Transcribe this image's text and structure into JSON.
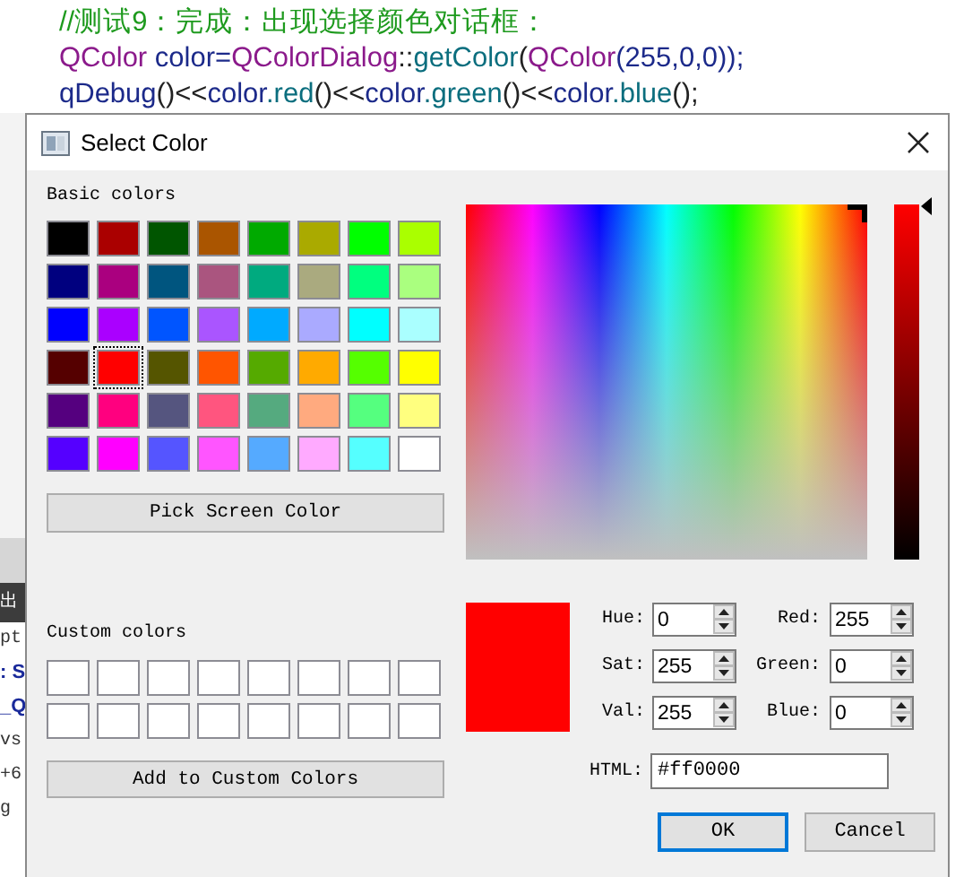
{
  "editor": {
    "code_lines": [
      [
        {
          "text": "//测试9：完成：出现选择颜色对话框：",
          "color": "#1e9a1e"
        }
      ],
      [
        {
          "text": "QColor",
          "color": "#8b1a8b"
        },
        {
          "text": " color=",
          "color": "#1c2a8a"
        },
        {
          "text": "QColorDialog",
          "color": "#8b1a8b"
        },
        {
          "text": "::",
          "color": "#222222"
        },
        {
          "text": "getColor",
          "color": "#0b6e7e"
        },
        {
          "text": "(",
          "color": "#222222"
        },
        {
          "text": "QColor",
          "color": "#8b1a8b"
        },
        {
          "text": "(255,0,0));",
          "color": "#1c2a8a"
        }
      ],
      [
        {
          "text": "qDebug",
          "color": "#1c2a8a"
        },
        {
          "text": "()<<",
          "color": "#222222"
        },
        {
          "text": "color",
          "color": "#1c2a8a"
        },
        {
          "text": ".red",
          "color": "#0b6e7e"
        },
        {
          "text": "()<<",
          "color": "#222222"
        },
        {
          "text": "color",
          "color": "#1c2a8a"
        },
        {
          "text": ".green",
          "color": "#0b6e7e"
        },
        {
          "text": "()<<",
          "color": "#222222"
        },
        {
          "text": "color",
          "color": "#1c2a8a"
        },
        {
          "text": ".blue",
          "color": "#0b6e7e"
        },
        {
          "text": "();",
          "color": "#222222"
        }
      ]
    ]
  },
  "background_fragments": [
    {
      "kind": "tab",
      "text": "出"
    },
    {
      "kind": "plain",
      "text": "pt"
    },
    {
      "kind": "bold",
      "text": ": S"
    },
    {
      "kind": "bold",
      "text": "_Q"
    },
    {
      "kind": "plain",
      "text": "vs"
    },
    {
      "kind": "plain",
      "text": "+6"
    },
    {
      "kind": "plain",
      "text": "g"
    }
  ],
  "dialog": {
    "title": "Select Color",
    "basic_colors": {
      "label": "Basic colors",
      "swatches": [
        {
          "color": "#000000",
          "selected": false
        },
        {
          "color": "#aa0000",
          "selected": false
        },
        {
          "color": "#005500",
          "selected": false
        },
        {
          "color": "#aa5500",
          "selected": false
        },
        {
          "color": "#00aa00",
          "selected": false
        },
        {
          "color": "#aaaa00",
          "selected": false
        },
        {
          "color": "#00ff00",
          "selected": false
        },
        {
          "color": "#aaff00",
          "selected": false
        },
        {
          "color": "#00007f",
          "selected": false
        },
        {
          "color": "#aa007f",
          "selected": false
        },
        {
          "color": "#00557f",
          "selected": false
        },
        {
          "color": "#aa557f",
          "selected": false
        },
        {
          "color": "#00aa7f",
          "selected": false
        },
        {
          "color": "#aaaa7f",
          "selected": false
        },
        {
          "color": "#00ff7f",
          "selected": false
        },
        {
          "color": "#aaff7f",
          "selected": false
        },
        {
          "color": "#0000ff",
          "selected": false
        },
        {
          "color": "#aa00ff",
          "selected": false
        },
        {
          "color": "#0055ff",
          "selected": false
        },
        {
          "color": "#aa55ff",
          "selected": false
        },
        {
          "color": "#00aaff",
          "selected": false
        },
        {
          "color": "#aaaaff",
          "selected": false
        },
        {
          "color": "#00ffff",
          "selected": false
        },
        {
          "color": "#aaffff",
          "selected": false
        },
        {
          "color": "#550000",
          "selected": false
        },
        {
          "color": "#ff0000",
          "selected": true
        },
        {
          "color": "#555500",
          "selected": false
        },
        {
          "color": "#ff5500",
          "selected": false
        },
        {
          "color": "#55aa00",
          "selected": false
        },
        {
          "color": "#ffaa00",
          "selected": false
        },
        {
          "color": "#55ff00",
          "selected": false
        },
        {
          "color": "#ffff00",
          "selected": false
        },
        {
          "color": "#55007f",
          "selected": false
        },
        {
          "color": "#ff007f",
          "selected": false
        },
        {
          "color": "#55557f",
          "selected": false
        },
        {
          "color": "#ff557f",
          "selected": false
        },
        {
          "color": "#55aa7f",
          "selected": false
        },
        {
          "color": "#ffaa7f",
          "selected": false
        },
        {
          "color": "#55ff7f",
          "selected": false
        },
        {
          "color": "#ffff7f",
          "selected": false
        },
        {
          "color": "#5500ff",
          "selected": false
        },
        {
          "color": "#ff00ff",
          "selected": false
        },
        {
          "color": "#5555ff",
          "selected": false
        },
        {
          "color": "#ff55ff",
          "selected": false
        },
        {
          "color": "#55aaff",
          "selected": false
        },
        {
          "color": "#ffaaff",
          "selected": false
        },
        {
          "color": "#55ffff",
          "selected": false
        },
        {
          "color": "#ffffff",
          "selected": false
        }
      ]
    },
    "pick_screen_button": "Pick Screen Color",
    "custom_colors": {
      "label": "Custom colors",
      "swatches": [
        {
          "color": "#ffffff"
        },
        {
          "color": "#ffffff"
        },
        {
          "color": "#ffffff"
        },
        {
          "color": "#ffffff"
        },
        {
          "color": "#ffffff"
        },
        {
          "color": "#ffffff"
        },
        {
          "color": "#ffffff"
        },
        {
          "color": "#ffffff"
        },
        {
          "color": "#ffffff"
        },
        {
          "color": "#ffffff"
        },
        {
          "color": "#ffffff"
        },
        {
          "color": "#ffffff"
        },
        {
          "color": "#ffffff"
        },
        {
          "color": "#ffffff"
        },
        {
          "color": "#ffffff"
        },
        {
          "color": "#ffffff"
        }
      ]
    },
    "add_custom_button": "Add to Custom Colors",
    "fields": [
      {
        "label": "Hue:",
        "value": "0"
      },
      {
        "label": "Red:",
        "value": "255"
      },
      {
        "label": "Sat:",
        "value": "255"
      },
      {
        "label": "Green:",
        "value": "0"
      },
      {
        "label": "Val:",
        "value": "255"
      },
      {
        "label": "Blue:",
        "value": "0"
      }
    ],
    "html": {
      "label": "HTML:",
      "value": "#ff0000"
    },
    "buttons": [
      {
        "label": "OK",
        "default": true
      },
      {
        "label": "Cancel",
        "default": false
      }
    ]
  }
}
